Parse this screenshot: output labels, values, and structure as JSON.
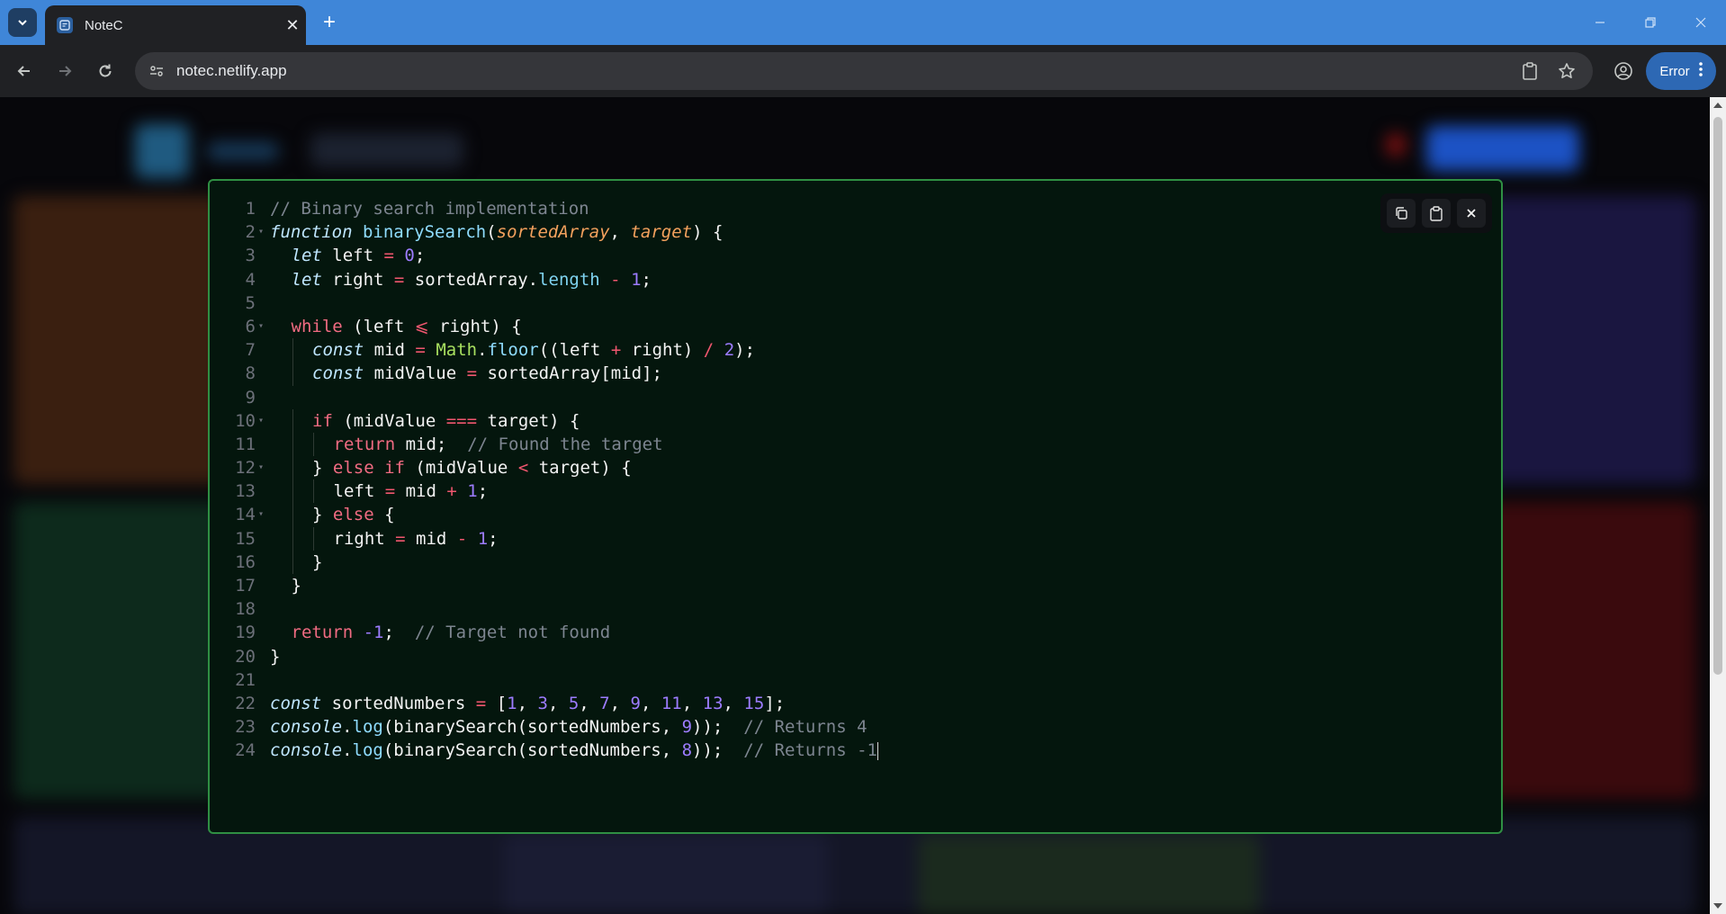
{
  "browser": {
    "tab_title": "NoteC",
    "new_tab_symbol": "+",
    "url": "notec.netlify.app",
    "profile_status": "Error",
    "accent": "#3f86d8"
  },
  "editor": {
    "border_color": "#2f8f43",
    "background": "#04160d",
    "actions": [
      "copy-icon",
      "clipboard-icon",
      "close-icon"
    ],
    "lines": [
      {
        "n": "1",
        "fold": false,
        "indent": 0,
        "tokens": [
          {
            "t": "// Binary search implementation",
            "c": "cm"
          }
        ]
      },
      {
        "n": "2",
        "fold": true,
        "indent": 0,
        "tokens": [
          {
            "t": "function",
            "c": "st"
          },
          {
            "t": " ",
            "c": "pl"
          },
          {
            "t": "binarySearch",
            "c": "fn"
          },
          {
            "t": "(",
            "c": "pl"
          },
          {
            "t": "sortedArray",
            "c": "pa"
          },
          {
            "t": ", ",
            "c": "pl"
          },
          {
            "t": "target",
            "c": "pa"
          },
          {
            "t": ") {",
            "c": "pl"
          }
        ]
      },
      {
        "n": "3",
        "fold": false,
        "indent": 1,
        "tokens": [
          {
            "t": "let",
            "c": "st"
          },
          {
            "t": " left ",
            "c": "pl"
          },
          {
            "t": "=",
            "c": "op"
          },
          {
            "t": " ",
            "c": "pl"
          },
          {
            "t": "0",
            "c": "nu"
          },
          {
            "t": ";",
            "c": "pl"
          }
        ]
      },
      {
        "n": "4",
        "fold": false,
        "indent": 1,
        "tokens": [
          {
            "t": "let",
            "c": "st"
          },
          {
            "t": " right ",
            "c": "pl"
          },
          {
            "t": "=",
            "c": "op"
          },
          {
            "t": " sortedArray.",
            "c": "pl"
          },
          {
            "t": "length",
            "c": "pr"
          },
          {
            "t": " ",
            "c": "pl"
          },
          {
            "t": "-",
            "c": "op"
          },
          {
            "t": " ",
            "c": "pl"
          },
          {
            "t": "1",
            "c": "nu"
          },
          {
            "t": ";",
            "c": "pl"
          }
        ]
      },
      {
        "n": "5",
        "fold": false,
        "indent": 0,
        "tokens": []
      },
      {
        "n": "6",
        "fold": true,
        "indent": 1,
        "tokens": [
          {
            "t": "while",
            "c": "kw"
          },
          {
            "t": " (left ",
            "c": "pl"
          },
          {
            "t": "⩽",
            "c": "op"
          },
          {
            "t": " right) {",
            "c": "pl"
          }
        ]
      },
      {
        "n": "7",
        "fold": false,
        "indent": 2,
        "tokens": [
          {
            "t": "const",
            "c": "st"
          },
          {
            "t": " mid ",
            "c": "pl"
          },
          {
            "t": "=",
            "c": "op"
          },
          {
            "t": " ",
            "c": "pl"
          },
          {
            "t": "Math",
            "c": "ob"
          },
          {
            "t": ".",
            "c": "pl"
          },
          {
            "t": "floor",
            "c": "fn"
          },
          {
            "t": "((left ",
            "c": "pl"
          },
          {
            "t": "+",
            "c": "op"
          },
          {
            "t": " right) ",
            "c": "pl"
          },
          {
            "t": "/",
            "c": "op"
          },
          {
            "t": " ",
            "c": "pl"
          },
          {
            "t": "2",
            "c": "nu"
          },
          {
            "t": ");",
            "c": "pl"
          }
        ]
      },
      {
        "n": "8",
        "fold": false,
        "indent": 2,
        "tokens": [
          {
            "t": "const",
            "c": "st"
          },
          {
            "t": " midValue ",
            "c": "pl"
          },
          {
            "t": "=",
            "c": "op"
          },
          {
            "t": " sortedArray[mid];",
            "c": "pl"
          }
        ]
      },
      {
        "n": "9",
        "fold": false,
        "indent": 0,
        "tokens": []
      },
      {
        "n": "10",
        "fold": true,
        "indent": 2,
        "tokens": [
          {
            "t": "if",
            "c": "kw"
          },
          {
            "t": " (midValue ",
            "c": "pl"
          },
          {
            "t": "===",
            "c": "op"
          },
          {
            "t": " target) {",
            "c": "pl"
          }
        ]
      },
      {
        "n": "11",
        "fold": false,
        "indent": 3,
        "tokens": [
          {
            "t": "return",
            "c": "kw"
          },
          {
            "t": " mid;  ",
            "c": "pl"
          },
          {
            "t": "// Found the target",
            "c": "cm"
          }
        ]
      },
      {
        "n": "12",
        "fold": true,
        "indent": 2,
        "tokens": [
          {
            "t": "} ",
            "c": "pl"
          },
          {
            "t": "else if",
            "c": "kw"
          },
          {
            "t": " (midValue ",
            "c": "pl"
          },
          {
            "t": "<",
            "c": "op"
          },
          {
            "t": " target) {",
            "c": "pl"
          }
        ]
      },
      {
        "n": "13",
        "fold": false,
        "indent": 3,
        "tokens": [
          {
            "t": "left ",
            "c": "pl"
          },
          {
            "t": "=",
            "c": "op"
          },
          {
            "t": " mid ",
            "c": "pl"
          },
          {
            "t": "+",
            "c": "op"
          },
          {
            "t": " ",
            "c": "pl"
          },
          {
            "t": "1",
            "c": "nu"
          },
          {
            "t": ";",
            "c": "pl"
          }
        ]
      },
      {
        "n": "14",
        "fold": true,
        "indent": 2,
        "tokens": [
          {
            "t": "} ",
            "c": "pl"
          },
          {
            "t": "else",
            "c": "kw"
          },
          {
            "t": " {",
            "c": "pl"
          }
        ]
      },
      {
        "n": "15",
        "fold": false,
        "indent": 3,
        "tokens": [
          {
            "t": "right ",
            "c": "pl"
          },
          {
            "t": "=",
            "c": "op"
          },
          {
            "t": " mid ",
            "c": "pl"
          },
          {
            "t": "-",
            "c": "op"
          },
          {
            "t": " ",
            "c": "pl"
          },
          {
            "t": "1",
            "c": "nu"
          },
          {
            "t": ";",
            "c": "pl"
          }
        ]
      },
      {
        "n": "16",
        "fold": false,
        "indent": 2,
        "tokens": [
          {
            "t": "}",
            "c": "pl"
          }
        ]
      },
      {
        "n": "17",
        "fold": false,
        "indent": 1,
        "tokens": [
          {
            "t": "}",
            "c": "pl"
          }
        ]
      },
      {
        "n": "18",
        "fold": false,
        "indent": 0,
        "tokens": []
      },
      {
        "n": "19",
        "fold": false,
        "indent": 1,
        "tokens": [
          {
            "t": "return",
            "c": "kw"
          },
          {
            "t": " ",
            "c": "pl"
          },
          {
            "t": "-1",
            "c": "nu"
          },
          {
            "t": ";  ",
            "c": "pl"
          },
          {
            "t": "// Target not found",
            "c": "cm"
          }
        ]
      },
      {
        "n": "20",
        "fold": false,
        "indent": 0,
        "tokens": [
          {
            "t": "}",
            "c": "pl"
          }
        ]
      },
      {
        "n": "21",
        "fold": false,
        "indent": 0,
        "tokens": []
      },
      {
        "n": "22",
        "fold": false,
        "indent": 0,
        "tokens": [
          {
            "t": "const",
            "c": "st"
          },
          {
            "t": " sortedNumbers ",
            "c": "pl"
          },
          {
            "t": "=",
            "c": "op"
          },
          {
            "t": " [",
            "c": "pl"
          },
          {
            "t": "1",
            "c": "nu"
          },
          {
            "t": ", ",
            "c": "pl"
          },
          {
            "t": "3",
            "c": "nu"
          },
          {
            "t": ", ",
            "c": "pl"
          },
          {
            "t": "5",
            "c": "nu"
          },
          {
            "t": ", ",
            "c": "pl"
          },
          {
            "t": "7",
            "c": "nu"
          },
          {
            "t": ", ",
            "c": "pl"
          },
          {
            "t": "9",
            "c": "nu"
          },
          {
            "t": ", ",
            "c": "pl"
          },
          {
            "t": "11",
            "c": "nu"
          },
          {
            "t": ", ",
            "c": "pl"
          },
          {
            "t": "13",
            "c": "nu"
          },
          {
            "t": ", ",
            "c": "pl"
          },
          {
            "t": "15",
            "c": "nu"
          },
          {
            "t": "];",
            "c": "pl"
          }
        ]
      },
      {
        "n": "23",
        "fold": false,
        "indent": 0,
        "tokens": [
          {
            "t": "console",
            "c": "st"
          },
          {
            "t": ".",
            "c": "pl"
          },
          {
            "t": "log",
            "c": "fn"
          },
          {
            "t": "(binarySearch(sortedNumbers, ",
            "c": "pl"
          },
          {
            "t": "9",
            "c": "nu"
          },
          {
            "t": "));  ",
            "c": "pl"
          },
          {
            "t": "// Returns 4",
            "c": "cm"
          }
        ]
      },
      {
        "n": "24",
        "fold": false,
        "indent": 0,
        "caret": true,
        "tokens": [
          {
            "t": "console",
            "c": "st"
          },
          {
            "t": ".",
            "c": "pl"
          },
          {
            "t": "log",
            "c": "fn"
          },
          {
            "t": "(binarySearch(sortedNumbers, ",
            "c": "pl"
          },
          {
            "t": "8",
            "c": "nu"
          },
          {
            "t": "));  ",
            "c": "pl"
          },
          {
            "t": "// Returns -1",
            "c": "cm"
          }
        ]
      }
    ]
  }
}
